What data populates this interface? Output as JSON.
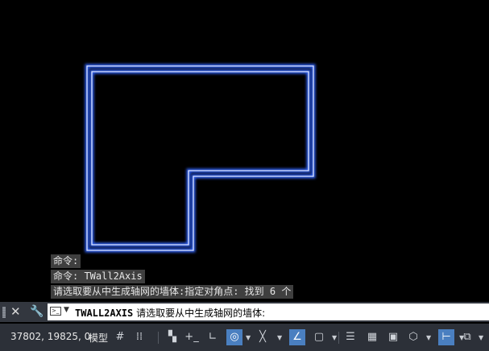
{
  "history": [
    "命令:",
    "命令: TWall2Axis",
    "请选取要从中生成轴网的墙体:指定对角点: 找到 6 个"
  ],
  "command_line": {
    "command_name": "TWALL2AXIS",
    "prompt": "请选取要从中生成轴网的墙体:"
  },
  "status_bar": {
    "coordinates": "37802, 19825, 0",
    "model_label": "模型",
    "icons": [
      {
        "name": "grid-icon",
        "glyph": "#",
        "active": false
      },
      {
        "name": "snap-icon",
        "glyph": "⁞⁞",
        "active": false
      },
      {
        "name": "infer-constraints-icon",
        "glyph": "▚",
        "active": false
      },
      {
        "name": "dynamic-input-icon",
        "glyph": "+_",
        "active": false
      },
      {
        "name": "ortho-icon",
        "glyph": "∟",
        "active": false
      },
      {
        "name": "polar-tracking-icon",
        "glyph": "◎",
        "active": true
      },
      {
        "name": "isodraft-icon",
        "glyph": "╳",
        "active": false
      },
      {
        "name": "object-snap-tracking-icon",
        "glyph": "∠",
        "active": true
      },
      {
        "name": "object-snap-icon",
        "glyph": "▢",
        "active": false
      },
      {
        "name": "lineweight-icon",
        "glyph": "☰",
        "active": false
      },
      {
        "name": "transparency-icon",
        "glyph": "▦",
        "active": false
      },
      {
        "name": "selection-cycling-icon",
        "glyph": "▣",
        "active": false
      },
      {
        "name": "3d-osnap-icon",
        "glyph": "⬡",
        "active": false
      },
      {
        "name": "ucs-icon",
        "glyph": "⊢",
        "active": true
      },
      {
        "name": "gizmo-icon",
        "glyph": "⧉",
        "active": false
      }
    ]
  },
  "colors": {
    "canvas_bg": "#000000",
    "wall_outer": "#2f5ff0",
    "wall_core": "#dfe6ff",
    "status_bg": "#2c3038",
    "active_icon": "#4a7fc0"
  }
}
